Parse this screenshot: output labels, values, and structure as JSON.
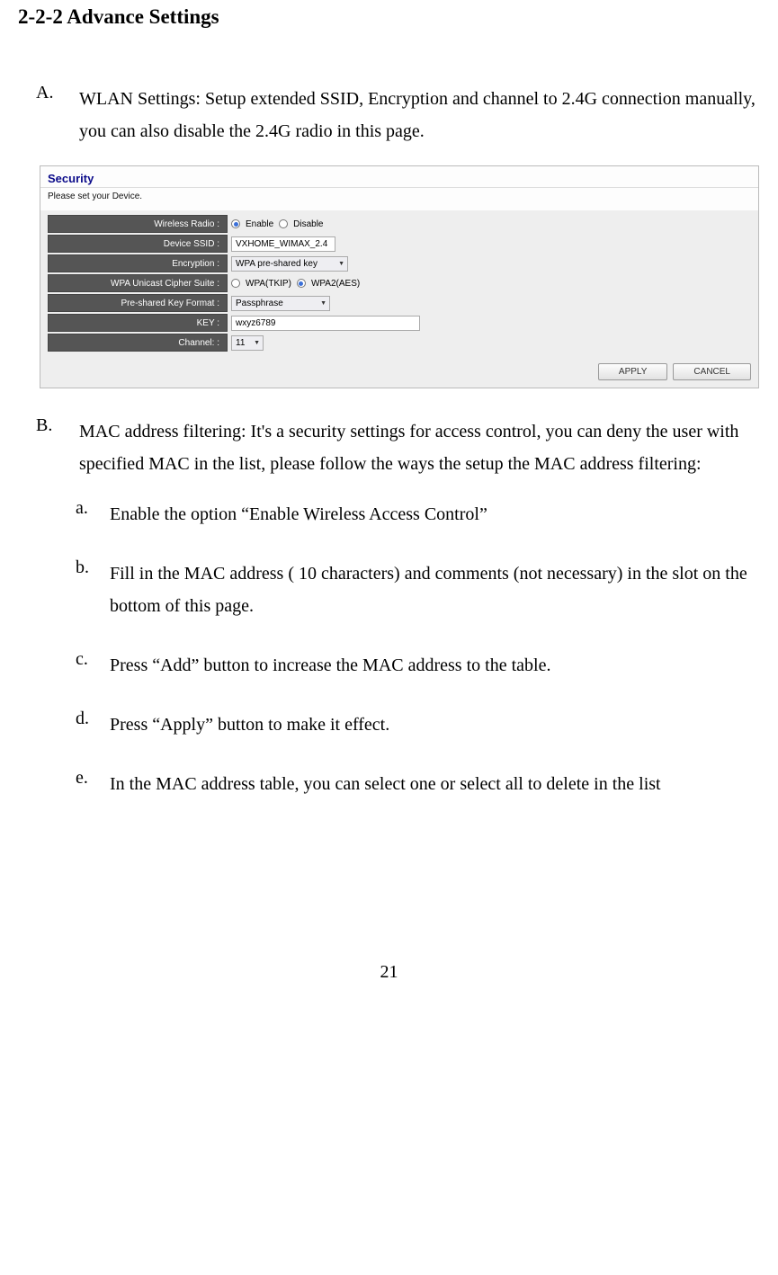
{
  "page": {
    "title": "2-2-2 Advance Settings",
    "number": "21"
  },
  "sections": {
    "A": {
      "marker": "A.",
      "text": "WLAN Settings: Setup extended SSID, Encryption and channel to 2.4G connection manually, you can also disable the 2.4G radio in this page."
    },
    "B": {
      "marker": "B.",
      "text": "MAC address filtering: It's a security settings for access control, you can deny the user with specified MAC in the list, please follow the ways the setup the MAC address filtering:",
      "sub": {
        "a": {
          "marker": "a.",
          "text": "Enable the option “Enable Wireless Access Control”"
        },
        "b": {
          "marker": "b.",
          "text": "Fill in the MAC address ( 10 characters) and comments (not necessary) in the slot on the bottom of this page."
        },
        "c": {
          "marker": "c.",
          "text": "Press “Add” button to increase the MAC address to the table."
        },
        "d": {
          "marker": "d.",
          "text": "Press “Apply” button to make it effect."
        },
        "e": {
          "marker": "e.",
          "text": "In the MAC address table, you can select one or select all to delete in the list"
        }
      }
    }
  },
  "panel": {
    "header": "Security",
    "subtext": "Please set your Device.",
    "rows": {
      "wireless_radio": {
        "label": "Wireless Radio :",
        "opt1": "Enable",
        "opt2": "Disable"
      },
      "ssid": {
        "label": "Device SSID :",
        "value": "VXHOME_WIMAX_2.4"
      },
      "encryption": {
        "label": "Encryption :",
        "value": "WPA pre-shared key"
      },
      "cipher": {
        "label": "WPA Unicast Cipher Suite :",
        "opt1": "WPA(TKIP)",
        "opt2": "WPA2(AES)"
      },
      "keyformat": {
        "label": "Pre-shared Key Format :",
        "value": "Passphrase"
      },
      "key": {
        "label": "KEY :",
        "value": "wxyz6789"
      },
      "channel": {
        "label": "Channel: :",
        "value": "11"
      }
    },
    "buttons": {
      "apply": "APPLY",
      "cancel": "CANCEL"
    }
  }
}
